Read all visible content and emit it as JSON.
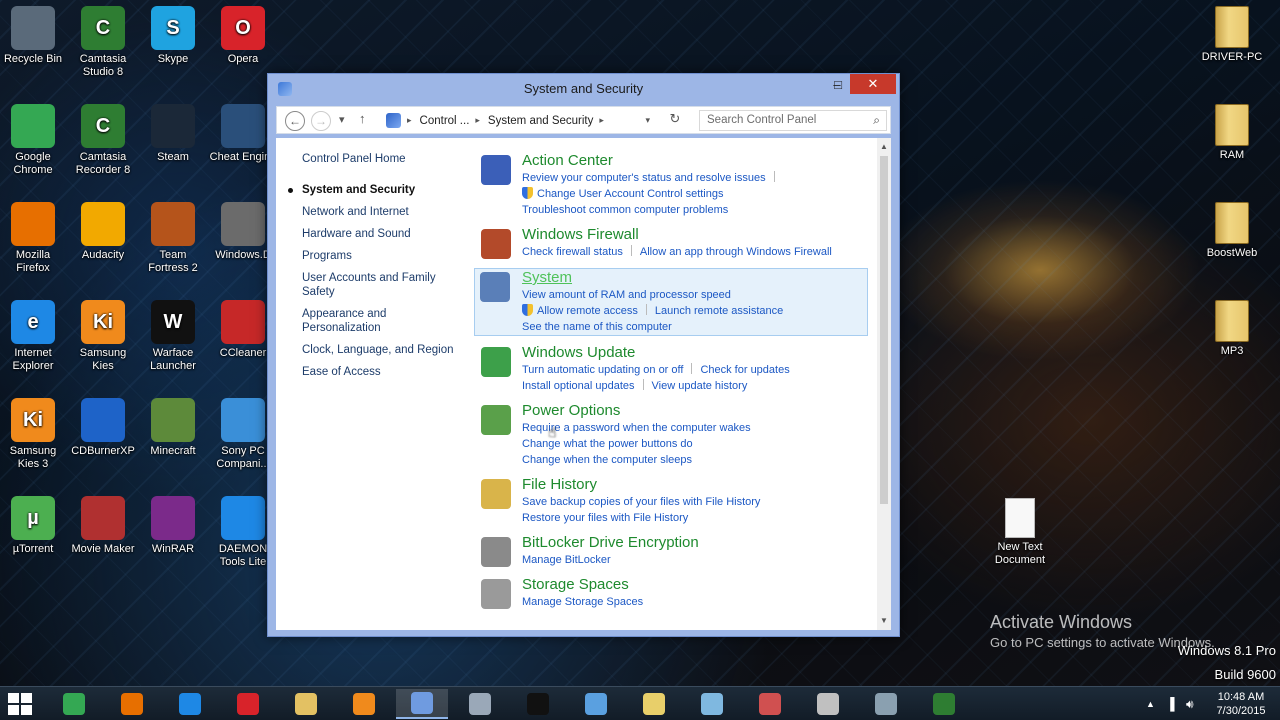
{
  "desktop": {
    "left_icons": [
      {
        "label": "Recycle Bin",
        "color": "#5a6a7a"
      },
      {
        "label": "Camtasia Studio 8",
        "color": "#2e7d32",
        "glyph": "C"
      },
      {
        "label": "Skype",
        "color": "#1fa3e0",
        "glyph": "S"
      },
      {
        "label": "Opera",
        "color": "#d8232a",
        "glyph": "O"
      },
      {
        "label": "Google Chrome",
        "color": "#34a853"
      },
      {
        "label": "Camtasia Recorder 8",
        "color": "#2e7d32",
        "glyph": "C"
      },
      {
        "label": "Steam",
        "color": "#1b2838"
      },
      {
        "label": "Cheat Engine",
        "color": "#2a4f7a"
      },
      {
        "label": "Mozilla Firefox",
        "color": "#e76f00"
      },
      {
        "label": "Audacity",
        "color": "#f2a900"
      },
      {
        "label": "Team Fortress 2",
        "color": "#b5541b"
      },
      {
        "label": "Windows.D",
        "color": "#6b6b6b"
      },
      {
        "label": "Internet Explorer",
        "color": "#1e88e5",
        "glyph": "e"
      },
      {
        "label": "Samsung Kies",
        "color": "#f08a1c",
        "glyph": "Ki"
      },
      {
        "label": "Warface Launcher",
        "color": "#111111",
        "glyph": "W"
      },
      {
        "label": "CCleaner",
        "color": "#c62828"
      },
      {
        "label": "Samsung Kies 3",
        "color": "#f08a1c",
        "glyph": "Ki"
      },
      {
        "label": "CDBurnerXP",
        "color": "#1e63c8"
      },
      {
        "label": "Minecraft",
        "color": "#5d8a3a"
      },
      {
        "label": "Sony PC Compani...",
        "color": "#3a8fd8"
      },
      {
        "label": "µTorrent",
        "color": "#4caf50",
        "glyph": "µ"
      },
      {
        "label": "Movie Maker",
        "color": "#b03030"
      },
      {
        "label": "WinRAR",
        "color": "#7b2a8a"
      },
      {
        "label": "DAEMON Tools Lite",
        "color": "#1e88e5"
      }
    ],
    "right_icons": [
      {
        "label": "DRIVER-PC"
      },
      {
        "label": "RAM"
      },
      {
        "label": "BoostWeb"
      },
      {
        "label": "MP3"
      }
    ],
    "text_file": "New Text Document"
  },
  "window": {
    "title": "System and Security",
    "breadcrumb": [
      "Control ...",
      "System and Security"
    ],
    "search_placeholder": "Search Control Panel",
    "left_nav": {
      "home": "Control Panel Home",
      "items": [
        "System and Security",
        "Network and Internet",
        "Hardware and Sound",
        "Programs",
        "User Accounts and Family Safety",
        "Appearance and Personalization",
        "Clock, Language, and Region",
        "Ease of Access"
      ]
    },
    "categories": [
      {
        "title": "Action Center",
        "icon_color": "#3b5fb8",
        "rows": [
          [
            {
              "text": "Review your computer's status and resolve issues"
            }
          ],
          [
            {
              "text": "Change User Account Control settings",
              "shield": true
            }
          ],
          [
            {
              "text": "Troubleshoot common computer problems"
            }
          ]
        ]
      },
      {
        "title": "Windows Firewall",
        "icon_color": "#b34a2a",
        "rows": [
          [
            {
              "text": "Check firewall status"
            },
            {
              "text": "Allow an app through Windows Firewall"
            }
          ]
        ]
      },
      {
        "title": "System",
        "icon_color": "#5a7fb8",
        "highlighted": true,
        "rows": [
          [
            {
              "text": "View amount of RAM and processor speed"
            }
          ],
          [
            {
              "text": "Allow remote access",
              "shield": true
            },
            {
              "text": "Launch remote assistance"
            }
          ],
          [
            {
              "text": "See the name of this computer"
            }
          ]
        ]
      },
      {
        "title": "Windows Update",
        "icon_color": "#3da04a",
        "rows": [
          [
            {
              "text": "Turn automatic updating on or off"
            },
            {
              "text": "Check for updates"
            }
          ],
          [
            {
              "text": "Install optional updates"
            },
            {
              "text": "View update history"
            }
          ]
        ]
      },
      {
        "title": "Power Options",
        "icon_color": "#5aa04a",
        "rows": [
          [
            {
              "text": "Require a password when the computer wakes"
            }
          ],
          [
            {
              "text": "Change what the power buttons do"
            }
          ],
          [
            {
              "text": "Change when the computer sleeps"
            }
          ]
        ]
      },
      {
        "title": "File History",
        "icon_color": "#d9b44a",
        "rows": [
          [
            {
              "text": "Save backup copies of your files with File History"
            }
          ],
          [
            {
              "text": "Restore your files with File History"
            }
          ]
        ]
      },
      {
        "title": "BitLocker Drive Encryption",
        "icon_color": "#8a8a8a",
        "rows": [
          [
            {
              "text": "Manage BitLocker"
            }
          ]
        ]
      },
      {
        "title": "Storage Spaces",
        "icon_color": "#9a9a9a",
        "rows": [
          [
            {
              "text": "Manage Storage Spaces"
            }
          ]
        ]
      }
    ]
  },
  "watermark": {
    "title": "Activate Windows",
    "subtitle": "Go to PC settings to activate Windows.",
    "edition": "Windows 8.1 Pro",
    "build": "Build 9600"
  },
  "taskbar": {
    "apps": [
      {
        "name": "chrome",
        "color": "#34a853"
      },
      {
        "name": "firefox",
        "color": "#e76f00"
      },
      {
        "name": "internet-explorer",
        "color": "#1e88e5"
      },
      {
        "name": "opera",
        "color": "#d8232a"
      },
      {
        "name": "file-explorer",
        "color": "#e3c163"
      },
      {
        "name": "media-player",
        "color": "#f08a1c"
      },
      {
        "name": "control-panel",
        "color": "#6f9be0",
        "active": true
      },
      {
        "name": "network",
        "color": "#9aa8b8"
      },
      {
        "name": "command-prompt",
        "color": "#111111"
      },
      {
        "name": "window-app",
        "color": "#5aa0e0"
      },
      {
        "name": "folder",
        "color": "#e8cf6a"
      },
      {
        "name": "notepad",
        "color": "#7fb8e0"
      },
      {
        "name": "paint",
        "color": "#d05050"
      },
      {
        "name": "tool",
        "color": "#c0c0c0"
      },
      {
        "name": "calculator",
        "color": "#8aa0b0"
      },
      {
        "name": "camtasia",
        "color": "#2e7d32"
      }
    ],
    "time": "10:48 AM",
    "date": "7/30/2015"
  }
}
